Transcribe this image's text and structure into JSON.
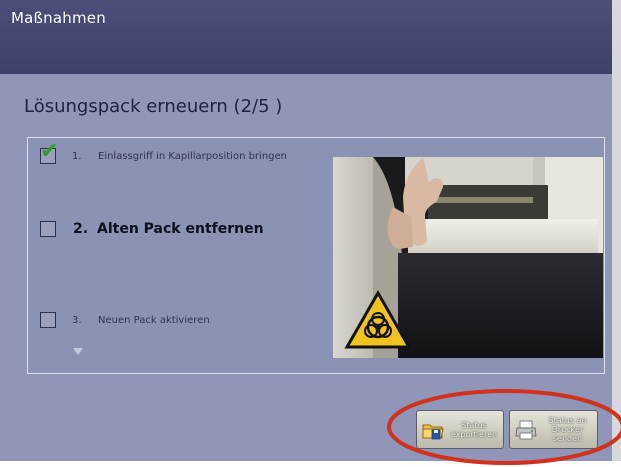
{
  "window": {
    "title": "Maßnahmen"
  },
  "page": {
    "heading": "Lösungspack erneuern (2/5 )"
  },
  "steps": [
    {
      "number": "1.",
      "label": "Einlassgriff in Kapillarposition bringen",
      "checked": true
    },
    {
      "number": "2.",
      "label": "Alten Pack entfernen",
      "checked": false,
      "active": true
    },
    {
      "number": "3.",
      "label": "Neuen Pack aktivieren",
      "checked": false
    }
  ],
  "buttons": {
    "export_status": {
      "line1": "Status",
      "line2": "exportieren",
      "icon": "folder-export-icon"
    },
    "print_status": {
      "line1": "Status an",
      "line2": "Drucker",
      "line3": "senden",
      "icon": "printer-icon"
    }
  },
  "colors": {
    "titlebar": "#43466f",
    "window": "#8f96b7",
    "annotation": "#d0321e",
    "check": "#2f9c2a"
  }
}
